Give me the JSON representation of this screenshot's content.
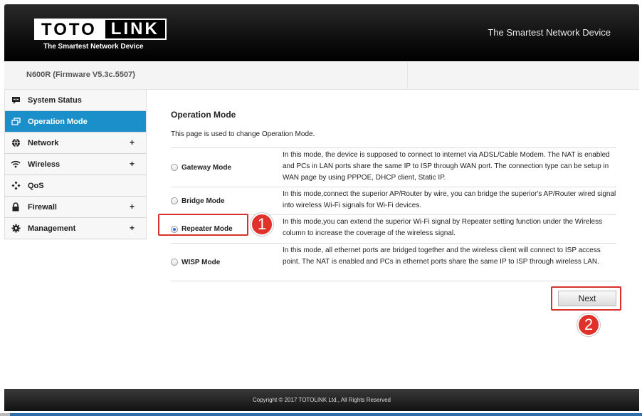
{
  "header": {
    "logo_left": "TOTO",
    "logo_right": "LINK",
    "logo_tagline": "The Smartest Network Device",
    "slogan": "The Smartest Network Device"
  },
  "firmware": "N600R (Firmware V5.3c.5507)",
  "sidebar": {
    "items": [
      {
        "label": "System Status",
        "icon": "chat-bubble-icon",
        "expandable": false,
        "active": false
      },
      {
        "label": "Operation Mode",
        "icon": "windows-icon",
        "expandable": false,
        "active": true
      },
      {
        "label": "Network",
        "icon": "globe-icon",
        "expandable": true,
        "active": false
      },
      {
        "label": "Wireless",
        "icon": "wifi-icon",
        "expandable": true,
        "active": false
      },
      {
        "label": "QoS",
        "icon": "qos-icon",
        "expandable": false,
        "active": false
      },
      {
        "label": "Firewall",
        "icon": "lock-icon",
        "expandable": true,
        "active": false
      },
      {
        "label": "Management",
        "icon": "gear-icon",
        "expandable": true,
        "active": false
      }
    ],
    "plus_symbol": "+"
  },
  "main": {
    "title": "Operation Mode",
    "description": "This page is used to change Operation Mode.",
    "modes": [
      {
        "label": "Gateway Mode",
        "checked": false,
        "text": "In this mode, the device is supposed to connect to internet via ADSL/Cable Modem. The NAT is enabled and PCs in LAN ports share the same IP to ISP through WAN port. The connection type can be setup in WAN page by using PPPOE, DHCP client, Static IP."
      },
      {
        "label": "Bridge Mode",
        "checked": false,
        "text": "In this mode,connect the superior AP/Router by wire, you can bridge the superior's AP/Router wired signal into wireless Wi-Fi signals for Wi-Fi devices."
      },
      {
        "label": "Repeater Mode",
        "checked": true,
        "text": "In this mode,you can extend the superior Wi-Fi signal by Repeater setting function under the Wireless column to increase the coverage of the wireless signal."
      },
      {
        "label": "WISP Mode",
        "checked": false,
        "text": "In this mode, all ethernet ports are bridged together and the wireless client will connect to ISP access point. The NAT is enabled and PCs in ethernet ports share the same IP to ISP through wireless LAN."
      }
    ],
    "next_label": "Next",
    "badge_1": "1",
    "badge_2": "2"
  },
  "footer": "Copyright © 2017 TOTOLINK Ltd.,   All Rights Reserved",
  "colors": {
    "accent": "#1a8fc9",
    "highlight": "#d9302c"
  }
}
